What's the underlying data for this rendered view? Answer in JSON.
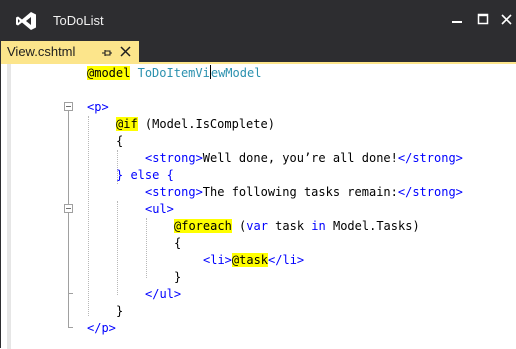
{
  "window": {
    "title": "ToDoList"
  },
  "tab": {
    "file_name": "View.cshtml"
  },
  "code": {
    "line1": {
      "directive": "@model",
      "type_a": "ToDoItemVi",
      "type_b": "ewModel"
    },
    "line2": {
      "open": "<p>"
    },
    "line3": {
      "razor": "@if",
      "cond": " (Model.IsComplete)"
    },
    "line4": {
      "brace": "{"
    },
    "line5": {
      "open": "<strong>",
      "text": "Well done, you’re all done!",
      "close": "</strong>"
    },
    "line6": {
      "text": "} else {"
    },
    "line7": {
      "open": "<strong>",
      "text": "The following tasks remain:",
      "close": "</strong>"
    },
    "line8": {
      "open": "<ul>"
    },
    "line9": {
      "razor": "@foreach",
      "rest_a": " (",
      "kw_var": "var",
      "rest_b": " task ",
      "kw_in": "in",
      "rest_c": " Model.Tasks)"
    },
    "line10": {
      "brace": "{"
    },
    "line11": {
      "open": "<li>",
      "razor": "@task",
      "close": "</li>"
    },
    "line12": {
      "brace": "}"
    },
    "line13": {
      "close": "</ul>"
    },
    "line14": {
      "brace": "}"
    },
    "line15": {
      "close": "</p>"
    }
  },
  "icons": {
    "logo": "visual-studio-logo-icon",
    "minimize": "minimize-icon",
    "maximize": "maximize-icon",
    "close": "close-icon",
    "pin": "pin-icon",
    "tab_close": "close-icon"
  },
  "colors": {
    "titlebar": "#2d2d30",
    "active_tab": "#fce58b",
    "razor_highlight": "#ffff00",
    "html_tag": "#0000ff",
    "type_name": "#2b91af"
  }
}
